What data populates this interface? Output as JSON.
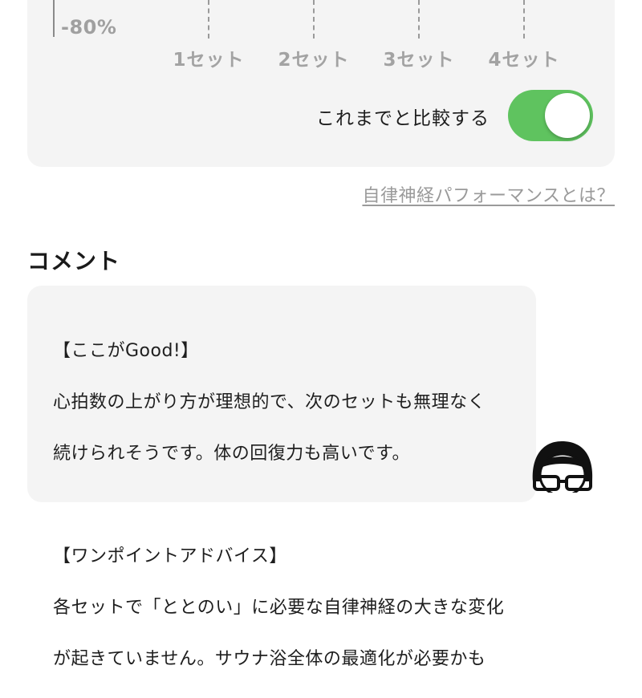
{
  "chart": {
    "y_tick_label": "-80%",
    "x_ticks": [
      "1セット",
      "2セット",
      "3セット",
      "4セット"
    ]
  },
  "compare": {
    "label": "これまでと比較する",
    "enabled": true
  },
  "help_link": "自律神経パフォーマンスとは？",
  "comment": {
    "title": "コメント",
    "good_heading": "【ここがGood!】",
    "good_text_line1": "心拍数の上がり方が理想的で、次のセットも無理なく",
    "good_text_line2": "続けられそうです。体の回復力も高いです。",
    "advice_heading": "【ワンポイントアドバイス】",
    "advice_text_line1": "各セットで「ととのい」に必要な自律神経の大きな変化",
    "advice_text_line2": "が起きていません。サウナ浴全体の最適化が必要かも"
  },
  "colors": {
    "toggle_on": "#5fc35f",
    "card_background": "#f4f4f4"
  },
  "icons": {
    "avatar": "man-with-glasses-avatar-icon"
  }
}
